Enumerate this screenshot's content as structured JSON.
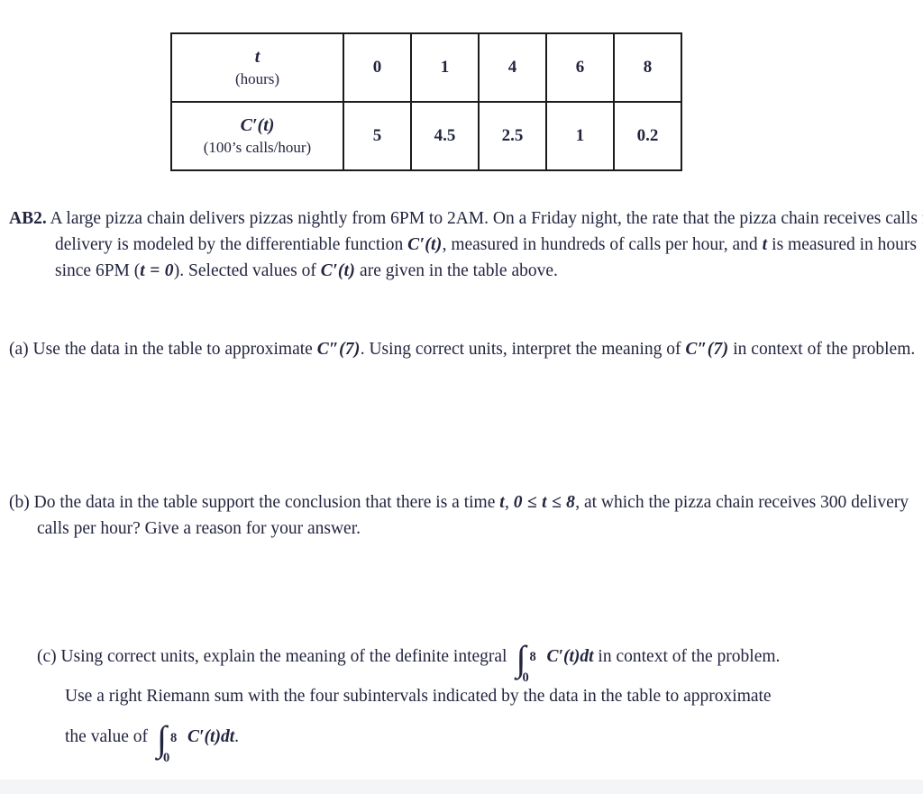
{
  "document": {
    "type": "calculus-free-response-problem",
    "text_color": "#23253f",
    "background": "#ffffff"
  },
  "table": {
    "row_labels": [
      {
        "symbol": "t",
        "units": "(hours)"
      },
      {
        "symbol": "C′(t)",
        "units": "(100’s calls/hour)"
      }
    ],
    "t_values": [
      "0",
      "1",
      "4",
      "6",
      "8"
    ],
    "c_prime_values": [
      "5",
      "4.5",
      "2.5",
      "1",
      "0.2"
    ]
  },
  "stem": {
    "tag": "AB2.",
    "line1": " A large pizza chain delivers pizzas nightly from 6PM to 2AM.  On a Friday night, the rate that the pizza",
    "line2": "chain receives calls for delivery is modeled by the differentiable function ",
    "func1": "C′(t)",
    "line3": ", measured in hundreds",
    "line4": "of calls per hour, and ",
    "var_t": "t",
    "line5": " is measured in hours since 6PM (",
    "eq_t0": "t = 0",
    "line6": ").  Selected values of ",
    "func2": "C′(t)",
    "line7": " are",
    "line8": "given in the table above."
  },
  "parts": {
    "a": {
      "label": "(a)",
      "text1": " Use the data in the table to approximate ",
      "math1": "C″(7)",
      "text2": ".  Using correct units, interpret the meaning of ",
      "math2": "C″(7)",
      "text3": "",
      "text4": "in context of the problem."
    },
    "b": {
      "label": "(b)",
      "text1": " Do the data in the table support the conclusion that there is a time ",
      "math1": "t",
      "text2": ", ",
      "math2": "0 ≤ t ≤ 8",
      "text3": ", at which the",
      "text4": "pizza chain receives 300 delivery calls per hour?  Give a reason for your answer."
    },
    "c": {
      "label": "(c)",
      "text1": " Using correct units, explain the meaning of the definite integral",
      "integral1": {
        "upper": "8",
        "lower": "0",
        "integrand": "C′(t)dt"
      },
      "text2": " in context of the problem.",
      "text3": "Use a right Riemann sum with the four subintervals indicated by the data in the table to approximate",
      "text4": "the value of",
      "integral2": {
        "upper": "8",
        "lower": "0",
        "integrand": "C′(t)dt"
      },
      "text5": "."
    }
  }
}
